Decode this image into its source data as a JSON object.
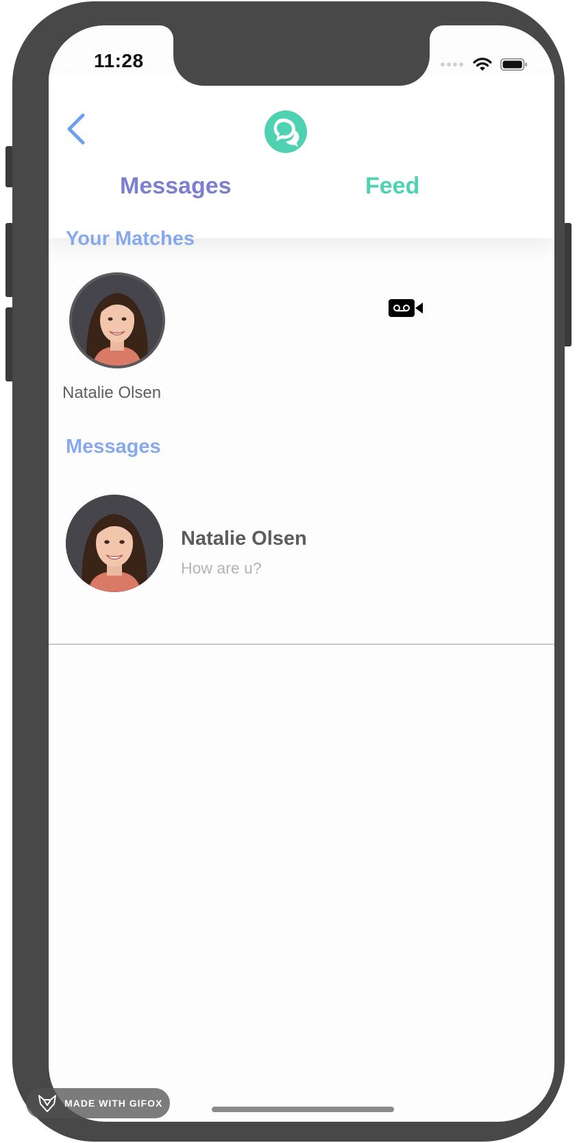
{
  "status_bar": {
    "time": "11:28",
    "icons": [
      "signal-dots-icon",
      "wifi-icon",
      "battery-icon"
    ]
  },
  "header": {
    "back_icon": "chevron-left-icon",
    "logo_icon": "chat-bubbles-icon",
    "tabs": [
      {
        "label": "Messages",
        "color": "#7b7fcf"
      },
      {
        "label": "Feed",
        "color": "#4fd2b2"
      }
    ]
  },
  "matches": {
    "title": "Your Matches",
    "items": [
      {
        "name": "Natalie Olsen",
        "avatar": "profile-photo"
      }
    ],
    "video_icon": "video-camera-icon"
  },
  "messages": {
    "title": "Messages",
    "items": [
      {
        "name": "Natalie Olsen",
        "preview": "How are u?",
        "avatar": "profile-photo"
      }
    ]
  },
  "watermark": {
    "text": "MADE WITH GIFOX",
    "icon": "fox-logo-icon"
  },
  "colors": {
    "accent_blue": "#86a9ee",
    "accent_purple": "#7b7fcf",
    "accent_teal": "#4fd2b2",
    "frame": "#484848"
  }
}
